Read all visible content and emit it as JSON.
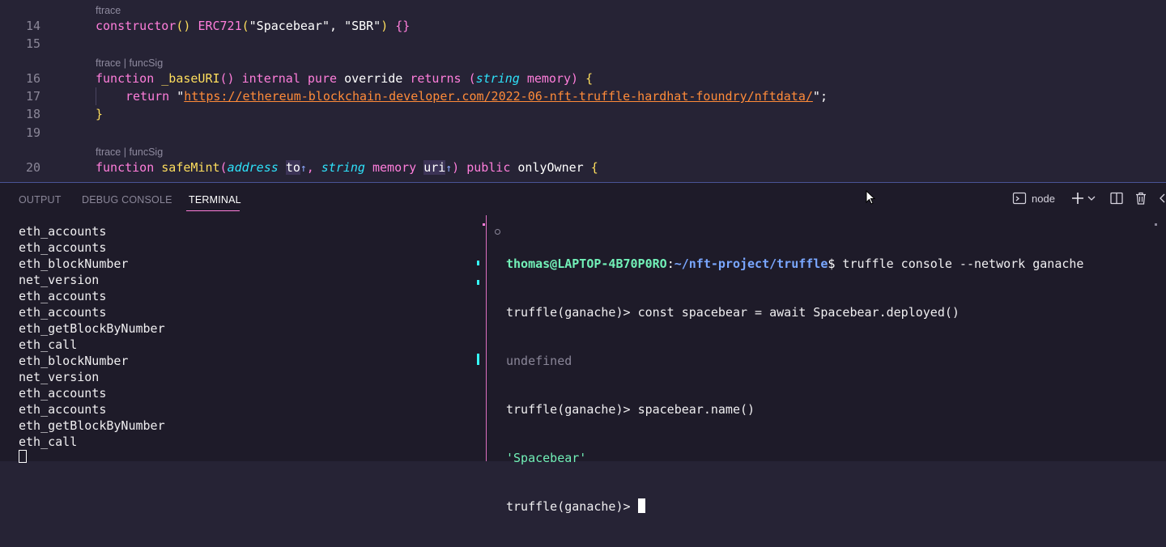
{
  "editor": {
    "lens": {
      "line14": "ftrace",
      "line16": "ftrace | funcSig",
      "line20": "ftrace | funcSig"
    },
    "line_numbers": [
      "14",
      "15",
      "16",
      "17",
      "18",
      "19",
      "20"
    ],
    "code": {
      "l14": {
        "kw": "constructor",
        "p1": "()",
        "sp": " ",
        "cls": "ERC721",
        "p2": "(",
        "s1": "\"Spacebear\"",
        "comma": ", ",
        "s2": "\"SBR\"",
        "p3": ")",
        "body": " {}"
      },
      "l16": {
        "kw": "function",
        "name": "_baseURI",
        "parens": "()",
        "internal": "internal",
        "pure": "pure",
        "override": "override",
        "returns": "returns",
        "open": "(",
        "type": "string",
        "memory": "memory",
        "close": ")",
        "brace": "{"
      },
      "l17": {
        "return": "return",
        "q1": "\"",
        "url": "https://ethereum-blockchain-developer.com/2022-06-nft-truffle-hardhat-foundry/nftdata/",
        "q2": "\"",
        "semi": ";"
      },
      "l18": {
        "brace": "}"
      },
      "l20": {
        "kw": "function",
        "name": "safeMint",
        "open": "(",
        "type1": "address",
        "param1": "to",
        "arrow": "↑",
        "comma": ", ",
        "type2": "string",
        "memory": "memory",
        "param2": "uri",
        "arrow2": "↑",
        "close": ")",
        "public": "public",
        "modifier": "onlyOwner",
        "brace": "{"
      }
    }
  },
  "panel": {
    "tabs": [
      {
        "label": "OUTPUT"
      },
      {
        "label": "DEBUG CONSOLE"
      },
      {
        "label": "TERMINAL",
        "active": true
      }
    ],
    "actions": {
      "terminal_icon": "terminal-icon",
      "profile_label": "node",
      "add_icon": "plus-icon",
      "dropdown_icon": "chevron-down-icon",
      "split_icon": "split-icon",
      "trash_icon": "trash-icon"
    }
  },
  "terminal_left": {
    "lines": [
      "eth_accounts",
      "eth_accounts",
      "eth_blockNumber",
      "net_version",
      "eth_accounts",
      "eth_accounts",
      "eth_getBlockByNumber",
      "eth_call",
      "eth_blockNumber",
      "net_version",
      "eth_accounts",
      "eth_accounts",
      "eth_getBlockByNumber",
      "eth_call"
    ]
  },
  "terminal_right": {
    "prompt_user": "thomas@LAPTOP-4B70P0RO",
    "prompt_colon": ":",
    "prompt_path": "~/nft-project/truffle",
    "prompt_dollar": "$",
    "command1": " truffle console --network ganache",
    "repl_prompt": "truffle(ganache)> ",
    "command2": "const spacebear = await Spacebear.deployed()",
    "output2": "undefined",
    "command3": "spacebear.name()",
    "output3": "'Spacebear'"
  },
  "colors": {
    "editor_bg": "#262335",
    "panel_bg": "#1e1b29",
    "accent_pink": "#ff7edb",
    "cyan": "#36f9f6",
    "yellow": "#fede5d",
    "orange": "#ff8b39",
    "green": "#72f1b8"
  }
}
